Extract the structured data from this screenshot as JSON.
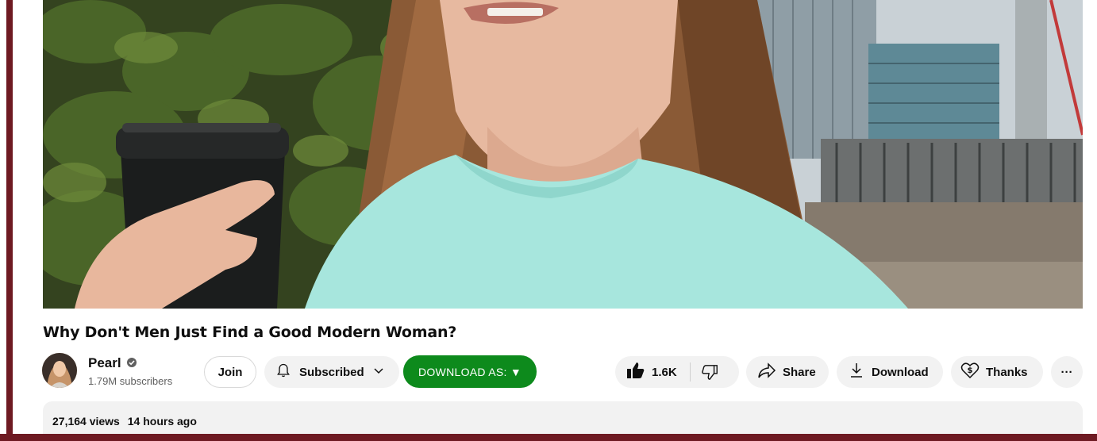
{
  "video": {
    "title": "Why Don't Men Just Find a Good Modern Woman?",
    "views": "27,164 views",
    "posted": "14 hours ago"
  },
  "channel": {
    "name": "Pearl",
    "subscribers": "1.79M subscribers",
    "verified_icon": "verified-check-icon"
  },
  "actions": {
    "join_label": "Join",
    "subscribed_label": "Subscribed",
    "download_as_label": "DOWNLOAD AS: ▼",
    "like_count": "1.6K",
    "share_label": "Share",
    "download_label": "Download",
    "thanks_label": "Thanks",
    "more_glyph": "···"
  },
  "colors": {
    "frame": "#6e1a22",
    "download_as_bg": "#0d8a1c",
    "pill_bg": "#f2f2f2"
  }
}
